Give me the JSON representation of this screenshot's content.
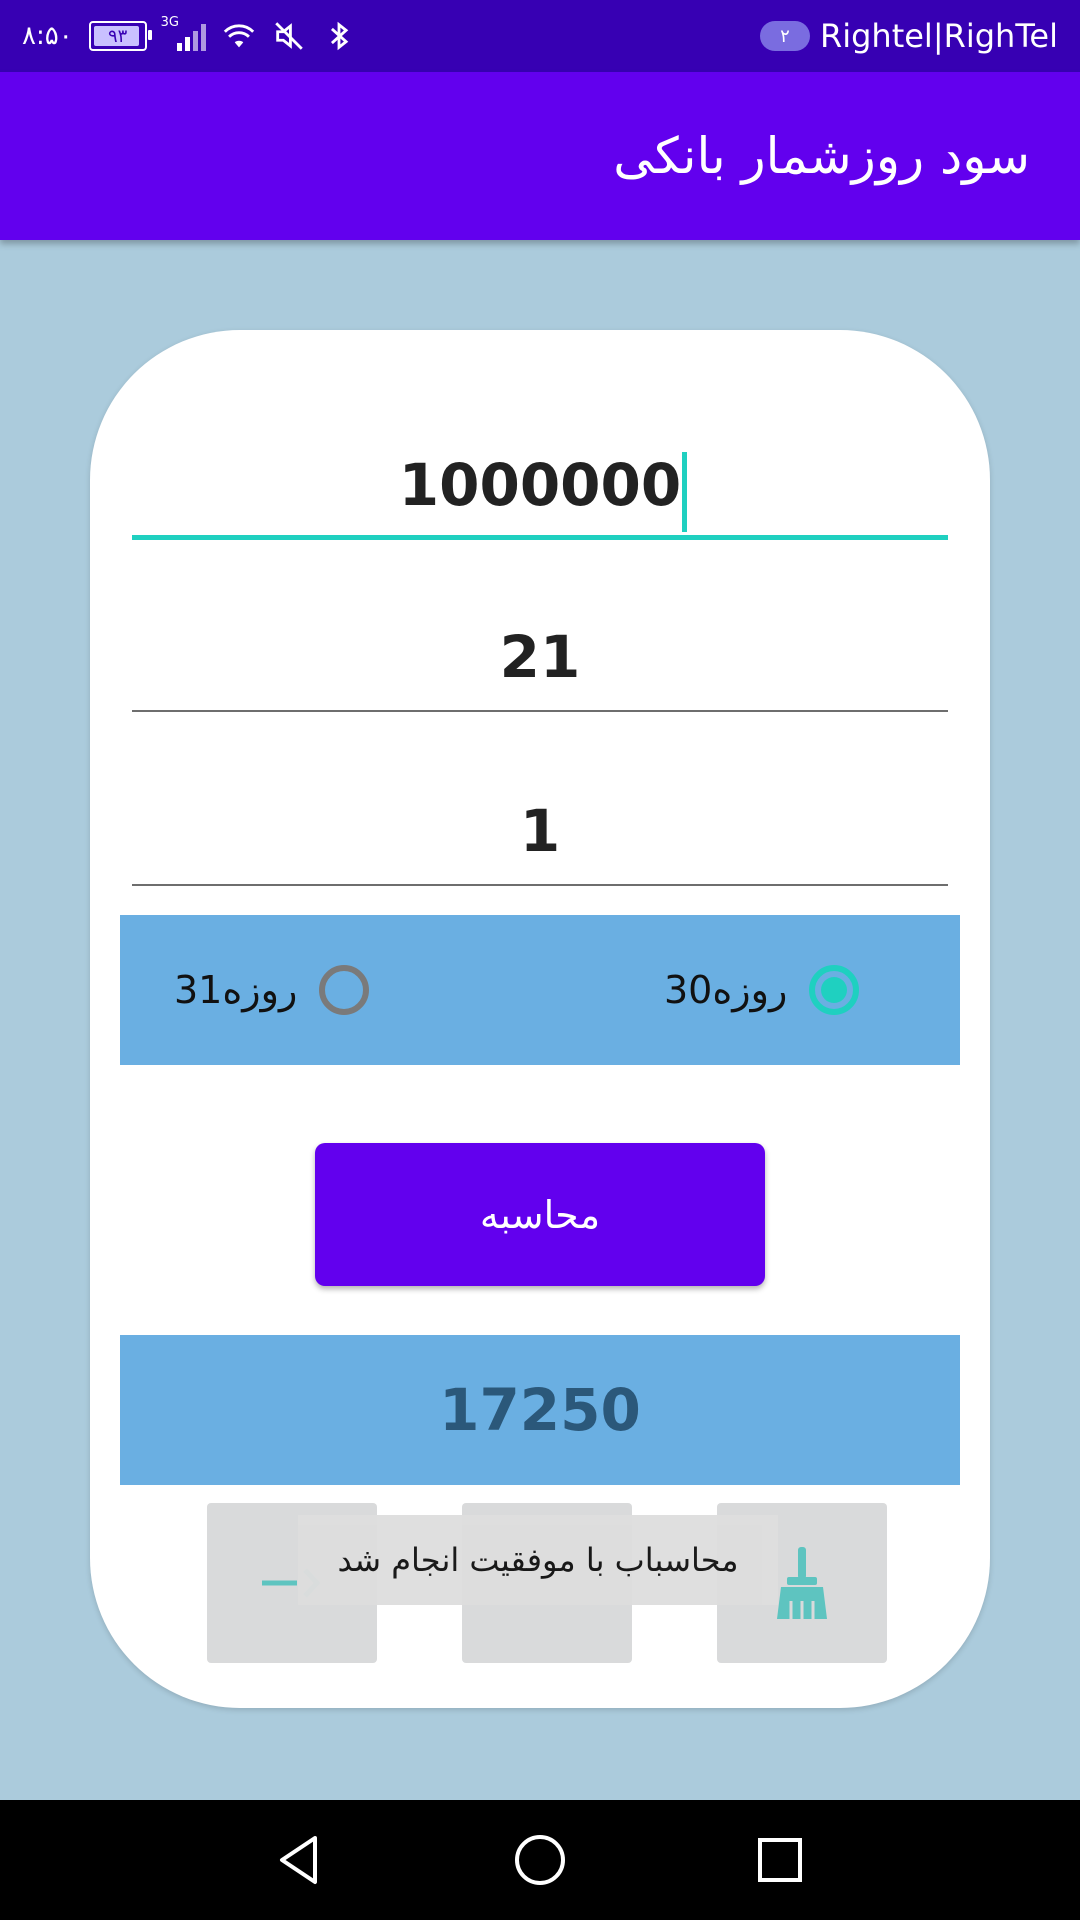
{
  "status_bar": {
    "time": "۸:۵۰",
    "battery": "۹۳",
    "network_type": "3G",
    "sim_badge": "۲",
    "carrier": "Rightel|RighTel",
    "icons": [
      "battery-icon",
      "signal-icon",
      "wifi-icon",
      "mute-icon",
      "bluetooth-icon"
    ]
  },
  "app_bar": {
    "title": "سود روزشمار بانکی"
  },
  "form": {
    "amount_value": "1000000",
    "rate_value": "21",
    "days_value": "1"
  },
  "day_basis": {
    "option_30_label": "30روزه",
    "option_31_label": "31روزه",
    "selected": "30روزه"
  },
  "calculate_button": {
    "label": "محاسبه"
  },
  "result": {
    "value": "17250"
  },
  "toast": {
    "message": "محاسباب با موفقیت انجام شد"
  },
  "tools": [
    "back-arrow-icon",
    "info-icon",
    "broom-icon"
  ],
  "colors": {
    "status_bar": "#3700b3",
    "app_bar": "#6200ee",
    "background": "#abcbdc",
    "accent": "#1fd0c0",
    "panel": "#6aafe2",
    "result_text": "#2b587a"
  }
}
